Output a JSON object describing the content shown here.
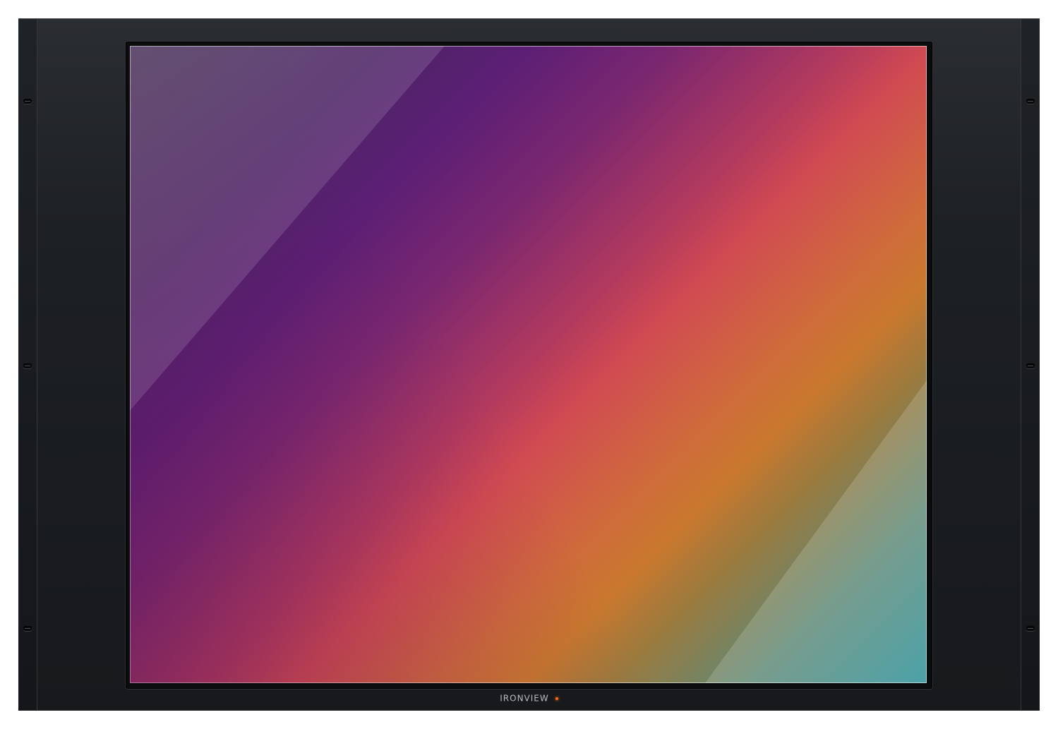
{
  "device": {
    "brand_name": "IRONVIEW",
    "power_led_color": "#ff6a1a",
    "power_led_state": "on"
  },
  "screen": {
    "content": "gradient-wallpaper",
    "colors": [
      "#4e2466",
      "#d14a52",
      "#c9782e",
      "#2a9098"
    ]
  },
  "rack": {
    "ear_slot_icons": [
      "rack-slot-icon",
      "rack-slot-icon",
      "rack-slot-icon"
    ]
  }
}
